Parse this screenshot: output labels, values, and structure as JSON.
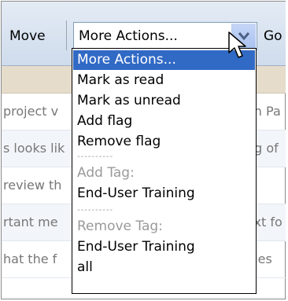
{
  "toolbar": {
    "move_label": "Move",
    "select_value": "More Actions...",
    "go_label": "Go"
  },
  "list_rows": [
    {
      "left": "project v",
      "right": "an Pa"
    },
    {
      "left": "s looks lik",
      "right": "ng of"
    },
    {
      "left": "review th",
      "right": ""
    },
    {
      "left": "rtant me",
      "right": "ext fo"
    },
    {
      "left": "hat the f",
      "right": "ples"
    }
  ],
  "dropdown": {
    "options": [
      {
        "label": "More Actions...",
        "state": "selected"
      },
      {
        "label": "Mark as read",
        "state": "normal"
      },
      {
        "label": "Mark as unread",
        "state": "normal"
      },
      {
        "label": "Add flag",
        "state": "normal"
      },
      {
        "label": "Remove flag",
        "state": "normal"
      },
      {
        "label": "----------",
        "state": "separator"
      },
      {
        "label": "Add Tag:",
        "state": "disabled"
      },
      {
        "label": "End-User Training",
        "state": "normal"
      },
      {
        "label": "----------",
        "state": "separator"
      },
      {
        "label": "Remove Tag:",
        "state": "disabled"
      },
      {
        "label": "End-User Training",
        "state": "normal"
      },
      {
        "label": "all",
        "state": "normal"
      }
    ]
  },
  "icons": {
    "dropdown_arrow": "chevron-down-icon",
    "cursor": "mouse-pointer-icon"
  },
  "colors": {
    "selection": "#316ac5",
    "toolbar": "#d8e2f0",
    "header_row": "#e6dccb"
  }
}
